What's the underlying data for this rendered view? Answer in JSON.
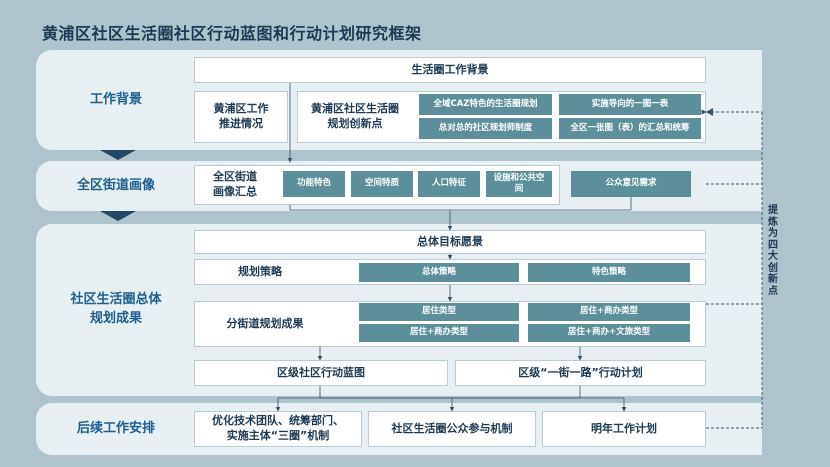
{
  "title": "黄浦区社区生活圈社区行动蓝图和行动计划研究框架",
  "sections": {
    "background": {
      "label": "工作背景",
      "header": "生活圈工作背景",
      "progress": "黄浦区工作\n推进情况",
      "innovation_label": "黄浦区社区生活圈\n规划创新点",
      "innovations": [
        "全域CAZ特色的生活圈规划",
        "实施导向的一图一表",
        "总对总的社区规划师制度",
        "全区一张图（表）的汇总和统筹"
      ]
    },
    "portrait": {
      "label": "全区街道画像",
      "summary": "全区街道\n画像汇总",
      "features": [
        "功能特色",
        "空间特质",
        "人口特征",
        "设施和公共空间"
      ],
      "public_opinion": "公众意见需求"
    },
    "outcomes": {
      "label": "社区生活圈总体\n规划成果",
      "vision": "总体目标愿景",
      "strategy_label": "规划策略",
      "strategies": [
        "总体策略",
        "特色策略"
      ],
      "sub_label": "分街道规划成果",
      "types": [
        "居住类型",
        "居住+商办类型",
        "居住+商办类型",
        "居住+商办+文旅类型"
      ],
      "blueprint": "区级社区行动蓝图",
      "action_plan": "区级“一街一路”行动计划"
    },
    "followup": {
      "label": "后续工作安排",
      "items": [
        "优化技术团队、统筹部门、\n实施主体“三圈”机制",
        "社区生活圈公众参与机制",
        "明年工作计划"
      ]
    }
  },
  "side_label": "提炼为四大创新点",
  "colors": {
    "background": "#aec3cc",
    "band": "#e8eff2",
    "teal": "#5c8f99",
    "navy": "#244764",
    "label_blue": "#1d5f8f"
  }
}
